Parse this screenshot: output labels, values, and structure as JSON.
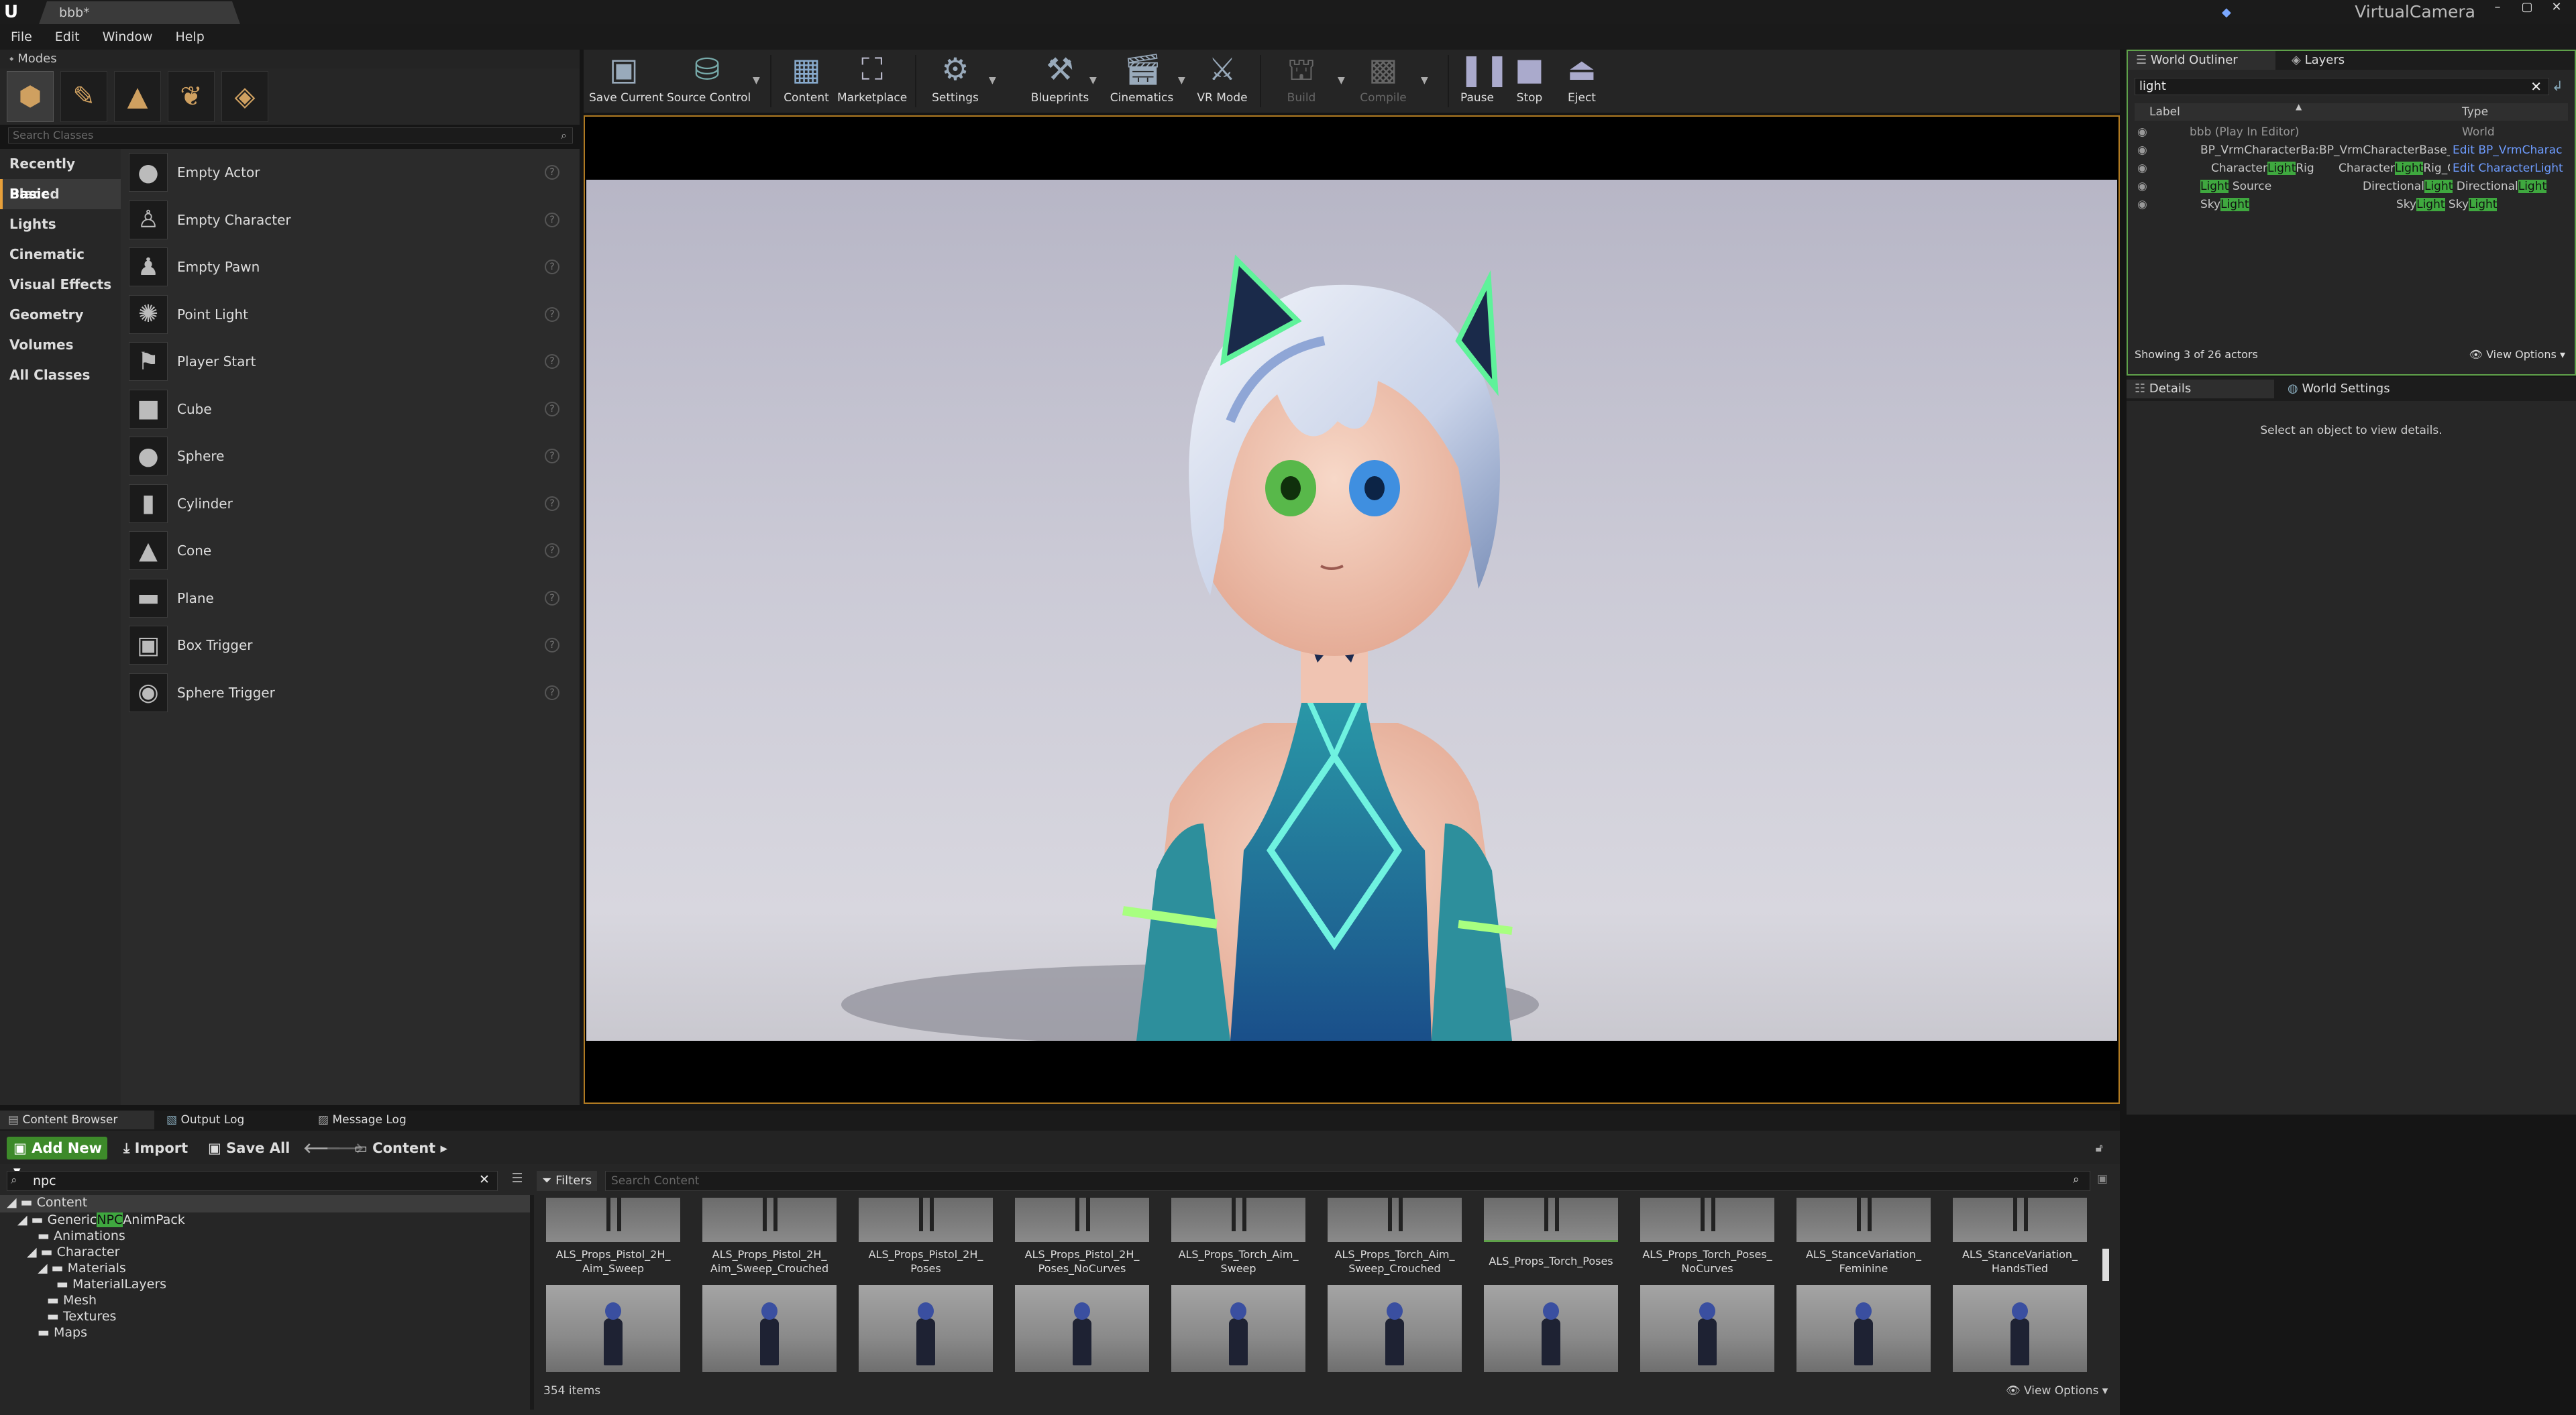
{
  "window": {
    "doc_tab": "bbb*",
    "app_logo": "U",
    "right_title": "VirtualCamera"
  },
  "menu": [
    "File",
    "Edit",
    "Window",
    "Help"
  ],
  "modes": {
    "tab_label": "Modes",
    "search_placeholder": "Search Classes",
    "categories": [
      "Recently Placed",
      "Basic",
      "Lights",
      "Cinematic",
      "Visual Effects",
      "Geometry",
      "Volumes",
      "All Classes"
    ],
    "selected_category": "Basic",
    "items": [
      "Empty Actor",
      "Empty Character",
      "Empty Pawn",
      "Point Light",
      "Player Start",
      "Cube",
      "Sphere",
      "Cylinder",
      "Cone",
      "Plane",
      "Box Trigger",
      "Sphere Trigger"
    ]
  },
  "toolbar": {
    "save_current": "Save Current",
    "source_control": "Source Control",
    "content": "Content",
    "marketplace": "Marketplace",
    "settings": "Settings",
    "blueprints": "Blueprints",
    "cinematics": "Cinematics",
    "vr_mode": "VR Mode",
    "build": "Build",
    "compile": "Compile",
    "pause": "Pause",
    "stop": "Stop",
    "eject": "Eject"
  },
  "outliner": {
    "tab_outliner": "World Outliner",
    "tab_layers": "Layers",
    "search_value": "light",
    "col_label": "Label",
    "col_type": "Type",
    "rows": [
      {
        "a": "bbb (Play In Editor)",
        "type": "World"
      },
      {
        "a": "BP_VrmCharacterBa:BP_VrmCharacterBase_C",
        "type": "Edit BP_VrmCharac"
      },
      {
        "a1": "Character",
        "hl": "Light",
        "a2": "Rig",
        "t1": "Character",
        "thl": "Light",
        "t2": "Rig_C",
        "link": "Edit CharacterLight"
      },
      {
        "hl": "Light",
        "a2": " Source",
        "t1": "Directional",
        "thl": "Light",
        "t2": " Directional",
        "thl2": "Light"
      },
      {
        "a1": "Sky",
        "hl": "Light",
        "t1": "Sky",
        "thl": "Light",
        "t2": " Sky",
        "thl2": "Light"
      }
    ],
    "footer": "Showing 3 of 26 actors",
    "view_options": "View Options"
  },
  "details": {
    "tab_details": "Details",
    "tab_world": "World Settings",
    "empty": "Select an object to view details."
  },
  "bottom_tabs": [
    "Content Browser",
    "Output Log",
    "Message Log"
  ],
  "content_browser": {
    "add_new": "Add New",
    "import": "Import",
    "save_all": "Save All",
    "path": "Content",
    "search_value": "npc",
    "filters": "Filters",
    "search_placeholder": "Search Content",
    "tree": {
      "root": "Content",
      "generic_pre": "Generic",
      "generic_hl": "NPC",
      "generic_post": "AnimPack",
      "children": [
        "Animations",
        "Character",
        "Materials",
        "MaterialLayers",
        "Mesh",
        "Textures",
        "Maps"
      ]
    },
    "assets_row1": [
      [
        "ALS_Props_Pistol_2H_",
        "Aim_Sweep"
      ],
      [
        "ALS_Props_Pistol_2H_",
        "Aim_Sweep_Crouched"
      ],
      [
        "ALS_Props_Pistol_2H_",
        "Poses"
      ],
      [
        "ALS_Props_Pistol_2H_",
        "Poses_NoCurves"
      ],
      [
        "ALS_Props_Torch_Aim_",
        "Sweep"
      ],
      [
        "ALS_Props_Torch_Aim_",
        "Sweep_Crouched"
      ],
      [
        "ALS_Props_Torch_Poses",
        ""
      ],
      [
        "ALS_Props_Torch_Poses_",
        "NoCurves"
      ],
      [
        "ALS_StanceVariation_",
        "Feminine"
      ],
      [
        "ALS_StanceVariation_",
        "HandsTied"
      ]
    ],
    "item_count": "354 items",
    "view_options": "View Options"
  },
  "colors": {
    "accent_orange": "#e8a03a",
    "filter_green": "#5fa14a",
    "highlight": "#3fa83f",
    "link_blue": "#6e9cff"
  }
}
